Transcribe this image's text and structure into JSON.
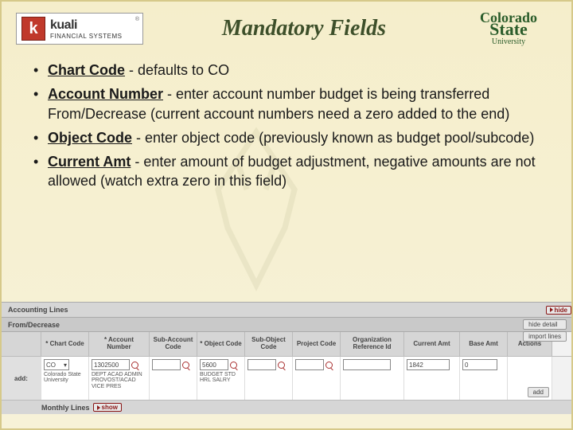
{
  "kuali": {
    "main": "kuali",
    "sub": "FINANCIAL SYSTEMS",
    "reg": "®"
  },
  "title": "Mandatory Fields",
  "csu": {
    "line1": "Colorado",
    "line2": "State",
    "line3": "University"
  },
  "bullets": [
    {
      "term": "Chart Code",
      "rest": " - defaults to CO"
    },
    {
      "term": "Account Number",
      "rest": " - enter account number budget is being transferred From/Decrease (current account numbers need a zero added to the end)"
    },
    {
      "term": "Object Code",
      "rest": " - enter object code (previously known as budget pool/subcode)"
    },
    {
      "term": "Current Amt",
      "rest": " - enter amount of budget adjustment, negative amounts are not allowed (watch extra zero in this field)"
    }
  ],
  "accounting": {
    "panel": "Accounting Lines",
    "hide": "hide",
    "hideDetail": "hide detail",
    "importLines": "import lines",
    "fromDecrease": "From/Decrease",
    "columns": [
      "* Chart Code",
      "* Account Number",
      "Sub-Account Code",
      "* Object Code",
      "Sub-Object Code",
      "Project Code",
      "Organization Reference Id",
      "Current Amt",
      "Base Amt",
      "Actions"
    ],
    "addLabel": "add:",
    "chartValue": "CO",
    "chartDesc": "Colorado State University",
    "acctValue": "1302500",
    "acctDesc": "DEPT ACAD ADMIN PROVOST/ACAD VICE PRES",
    "objValue": "5600",
    "objDesc": "BUDGET STD HRL SALRY",
    "currentAmt": "1842",
    "baseAmt": "0",
    "monthlyLines": "Monthly Lines",
    "show": "show",
    "add": "add"
  }
}
